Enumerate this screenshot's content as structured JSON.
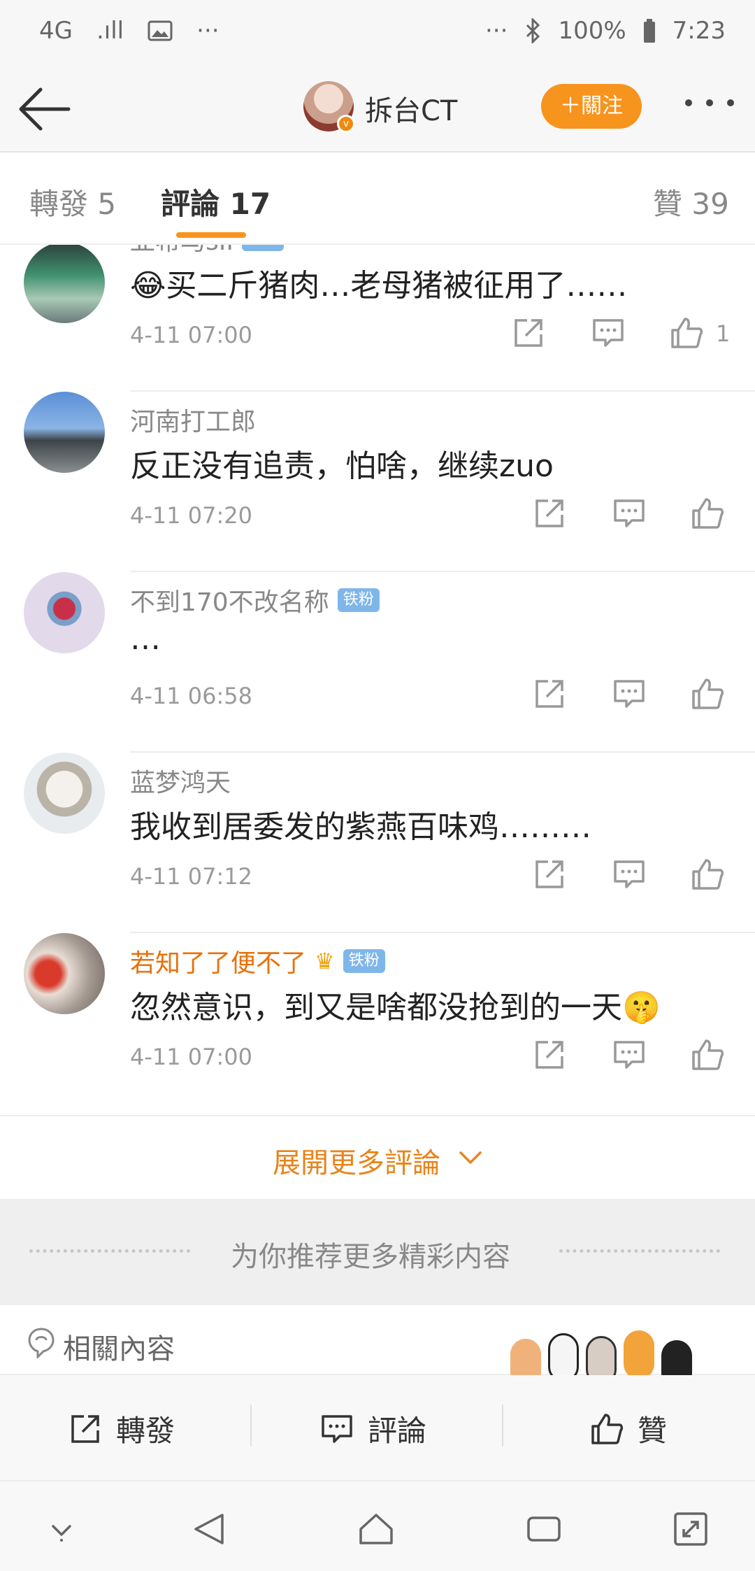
{
  "status_bar": {
    "network": "4G",
    "signal": ".ıll",
    "more": "···",
    "more_right": "···",
    "battery": "100%",
    "time": "7:23"
  },
  "header": {
    "title": "拆台CT",
    "verified": "v",
    "follow_label": "＋關注"
  },
  "tabs": {
    "repost": "轉發 5",
    "comment": "評論 17",
    "like": "贊 39"
  },
  "comments": [
    {
      "name": "亚希马sII",
      "badge": "铁粉",
      "text": "😂买二斤猪肉…老母猪被征用了……",
      "time": "4-11 07:00",
      "likes": "1"
    },
    {
      "name": "河南打工郎",
      "badge": "",
      "text": "反正没有追责，怕啥，继续zuo",
      "time": "4-11 07:20",
      "likes": ""
    },
    {
      "name": "不到170不改名称",
      "badge": "铁粉",
      "text": "…",
      "time": "4-11 06:58",
      "likes": ""
    },
    {
      "name": "蓝梦鸿天",
      "badge": "",
      "text": "我收到居委发的紫燕百味鸡………",
      "time": "4-11 07:12",
      "likes": ""
    },
    {
      "name": "若知了了便不了",
      "badge": "铁粉",
      "text": "忽然意识，到又是啥都没抢到的一天🤫",
      "time": "4-11 07:00",
      "likes": ""
    }
  ],
  "expand_label": "展開更多評論",
  "recommend_label": "为你推荐更多精彩内容",
  "related_label": "相關內容",
  "actions": {
    "repost": "轉發",
    "comment": "評論",
    "like": "贊"
  },
  "colors": {
    "accent": "#f7941d",
    "badge": "#7fb6ea",
    "vip_name": "#e8710a"
  }
}
